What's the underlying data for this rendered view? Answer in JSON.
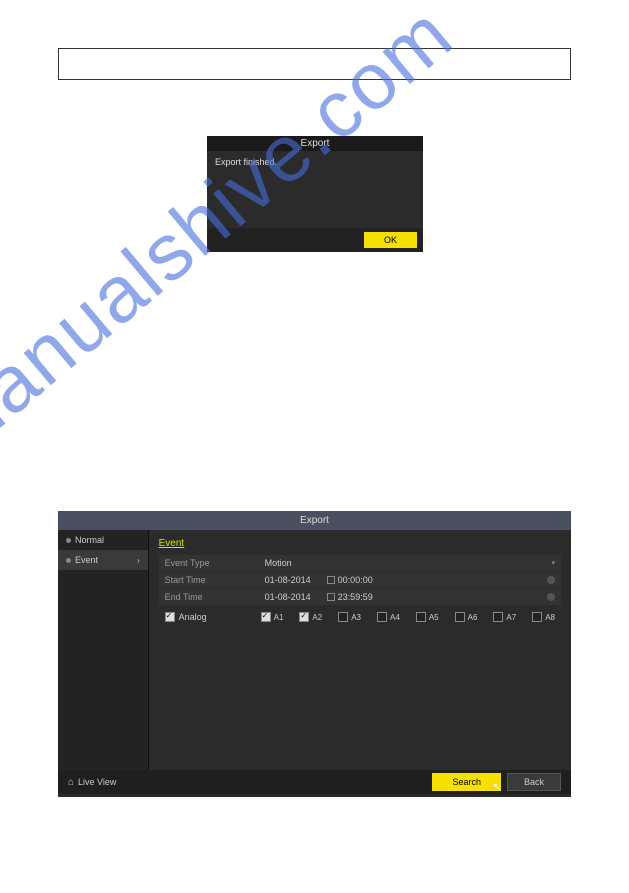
{
  "watermark": "manualshive.com",
  "dialog": {
    "title": "Export",
    "message": "Export finished.",
    "ok": "OK"
  },
  "panel": {
    "title": "Export",
    "sidebar": {
      "normal": "Normal",
      "event": "Event"
    },
    "tab": "Event",
    "rows": {
      "eventType": {
        "label": "Event Type",
        "value": "Motion"
      },
      "startTime": {
        "label": "Start Time",
        "date": "01-08-2014",
        "time": "00:00:00"
      },
      "endTime": {
        "label": "End Time",
        "date": "01-08-2014",
        "time": "23:59:59"
      }
    },
    "analog": {
      "label": "Analog",
      "channels": [
        "A1",
        "A2",
        "A3",
        "A4",
        "A5",
        "A6",
        "A7",
        "A8"
      ]
    },
    "footer": {
      "liveView": "Live View",
      "search": "Search",
      "back": "Back"
    }
  }
}
